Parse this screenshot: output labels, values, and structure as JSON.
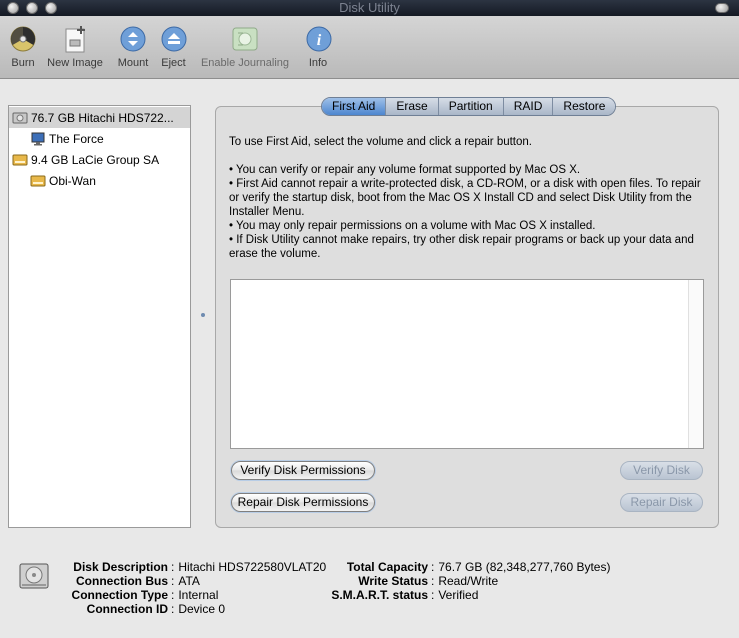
{
  "window": {
    "title": "Disk Utility"
  },
  "toolbar": {
    "items": [
      {
        "label": "Burn",
        "icon": "burn-icon",
        "enabled": true
      },
      {
        "label": "New Image",
        "icon": "new-image-icon",
        "enabled": true
      },
      {
        "label": "Mount",
        "icon": "mount-icon",
        "enabled": true
      },
      {
        "label": "Eject",
        "icon": "eject-icon",
        "enabled": true
      },
      {
        "label": "Enable Journaling",
        "icon": "enable-journaling-icon",
        "enabled": false
      },
      {
        "label": "Info",
        "icon": "info-icon",
        "enabled": true
      }
    ]
  },
  "sidebar": {
    "items": [
      {
        "label": "76.7 GB Hitachi HDS722...",
        "type": "disk",
        "icon": "hard-disk-icon",
        "selected": true
      },
      {
        "label": "The Force",
        "type": "volume",
        "icon": "monitor-volume-icon"
      },
      {
        "label": "9.4 GB LaCie Group SA",
        "type": "disk",
        "icon": "external-disk-icon"
      },
      {
        "label": "Obi-Wan",
        "type": "volume",
        "icon": "external-volume-icon"
      }
    ]
  },
  "tabs": [
    {
      "label": "First Aid",
      "active": true
    },
    {
      "label": "Erase",
      "active": false
    },
    {
      "label": "Partition",
      "active": false
    },
    {
      "label": "RAID",
      "active": false
    },
    {
      "label": "Restore",
      "active": false
    }
  ],
  "first_aid": {
    "intro": "To use First Aid, select the volume and click a repair button.",
    "bullets": [
      "• You can verify or repair any volume format supported by Mac OS X.",
      "• First Aid cannot repair a write-protected disk, a CD-ROM, or a disk with open files. To repair or verify the startup disk, boot from the Mac OS X Install CD and select Disk Utility from the Installer Menu.",
      "• You may only repair permissions on a volume with Mac OS X installed.",
      "• If Disk Utility cannot make repairs, try other disk repair programs or back up your data and erase the volume."
    ],
    "buttons": {
      "verify_permissions": "Verify Disk Permissions",
      "repair_permissions": "Repair Disk Permissions",
      "verify_disk": "Verify Disk",
      "repair_disk": "Repair Disk"
    }
  },
  "disk_info": {
    "left": [
      {
        "key": "Disk Description",
        "value": "Hitachi HDS722580VLAT20"
      },
      {
        "key": "Connection Bus",
        "value": "ATA"
      },
      {
        "key": "Connection Type",
        "value": "Internal"
      },
      {
        "key": "Connection ID",
        "value": "Device 0"
      }
    ],
    "right": [
      {
        "key": "Total Capacity",
        "value": "76.7 GB (82,348,277,760 Bytes)"
      },
      {
        "key": "Write Status",
        "value": "Read/Write"
      },
      {
        "key": "S.M.A.R.T. status",
        "value": "Verified"
      }
    ]
  },
  "colors": {
    "tab_active": "#4d86cf",
    "tab_inactive": "#a9b6c8",
    "selection": "#d4d4d4"
  }
}
